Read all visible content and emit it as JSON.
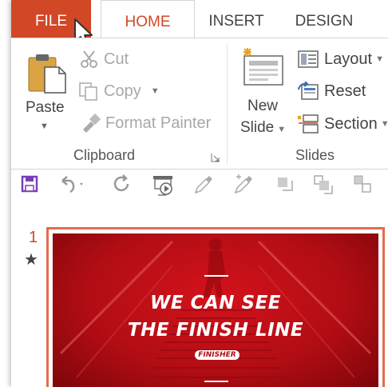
{
  "tabs": {
    "file": "FILE",
    "home": "HOME",
    "insert": "INSERT",
    "design": "DESIGN"
  },
  "clipboard": {
    "paste": "Paste",
    "cut": "Cut",
    "copy": "Copy",
    "format_painter": "Format Painter",
    "group_label": "Clipboard"
  },
  "slides_group": {
    "new_slide_line1": "New",
    "new_slide_line2": "Slide",
    "layout": "Layout",
    "reset": "Reset",
    "section": "Section",
    "group_label": "Slides"
  },
  "slide_panel": {
    "slide_number": "1",
    "star": "★",
    "title_line1": "WE CAN SEE",
    "title_line2": "THE FINISH LINE",
    "badge": "FINISHER"
  },
  "colors": {
    "accent": "#d24726",
    "slide_red": "#c8101a",
    "thumb_border": "#e76b4b"
  }
}
